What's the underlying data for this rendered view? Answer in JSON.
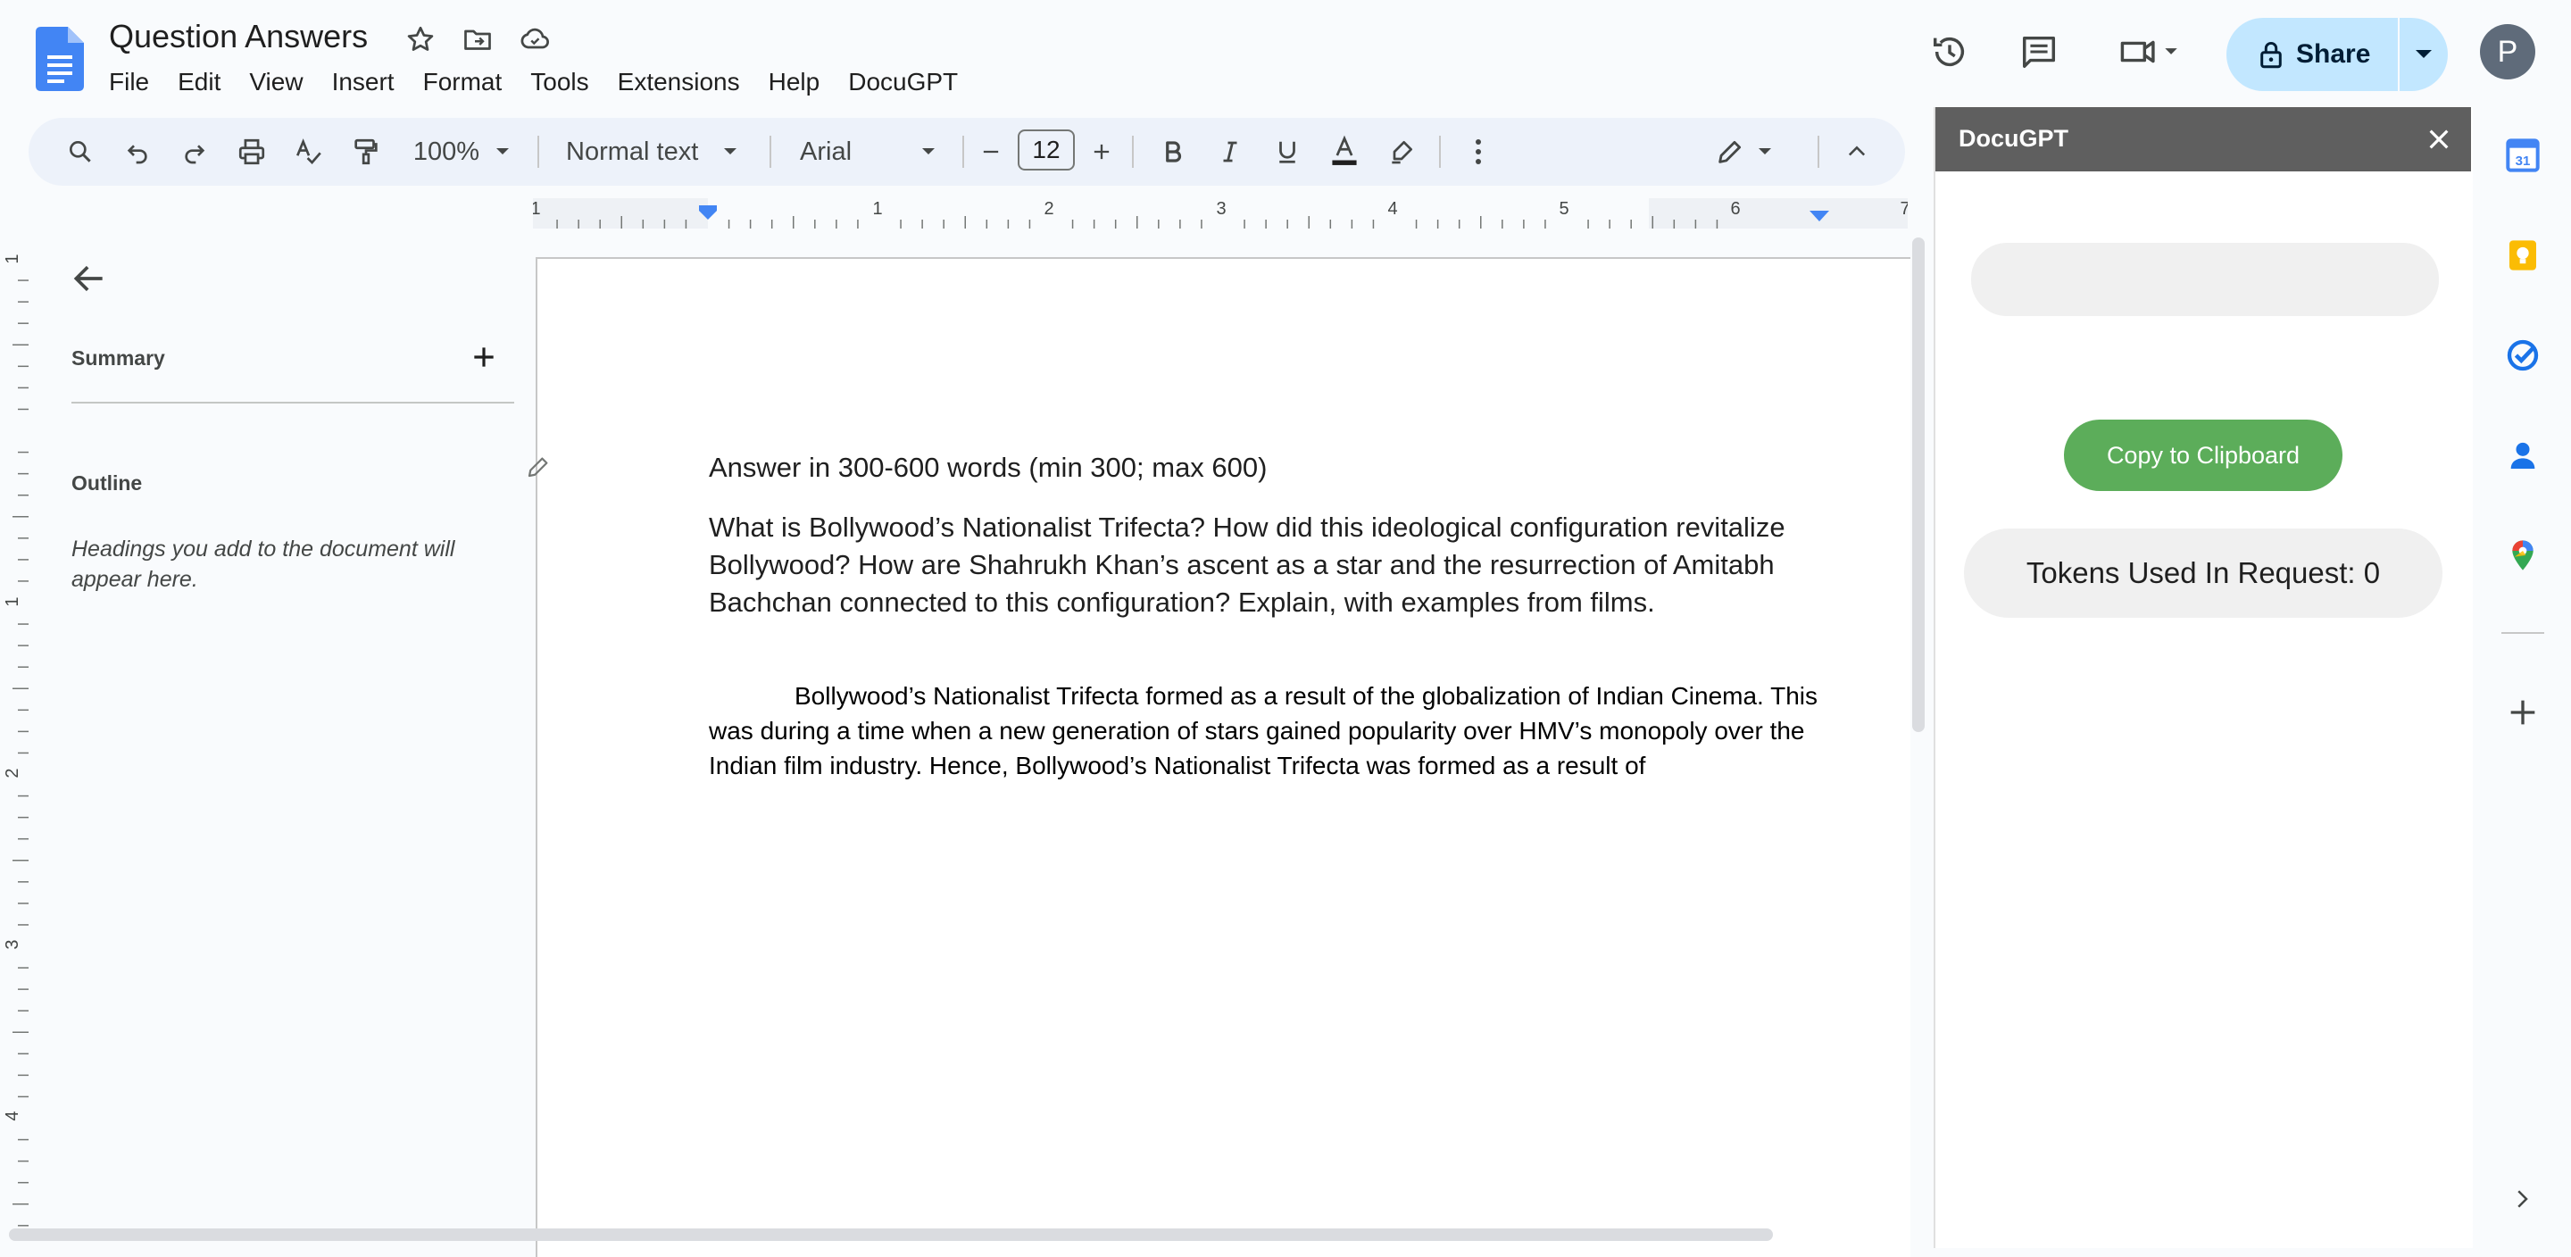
{
  "header": {
    "title": "Question Answers",
    "menu": [
      "File",
      "Edit",
      "View",
      "Insert",
      "Format",
      "Tools",
      "Extensions",
      "Help",
      "DocuGPT"
    ],
    "share_label": "Share",
    "avatar_letter": "P"
  },
  "toolbar": {
    "zoom": "100%",
    "style": "Normal text",
    "font": "Arial",
    "font_size": "12"
  },
  "ruler": {
    "h_ticks": [
      "1",
      "1",
      "2",
      "3",
      "4",
      "5",
      "6",
      "7"
    ],
    "v_ticks": [
      "1",
      "1",
      "2",
      "3",
      "4"
    ]
  },
  "outline_panel": {
    "summary_label": "Summary",
    "outline_label": "Outline",
    "outline_hint": "Headings you add to the document will appear here."
  },
  "document": {
    "heading": "Answer in 300-600 words (min 300; max 600)",
    "question": "What is Bollywood’s Nationalist Trifecta? How did this ideological configuration revitalize Bollywood? How are Shahrukh Khan’s ascent as a star and the resurrection of Amitabh Bachchan connected to this configuration? Explain, with examples from films.",
    "answer": "Bollywood’s Nationalist Trifecta formed as a result of the globalization of Indian Cinema. This was during a time when a new generation of stars gained popularity over HMV’s monopoly over the Indian film industry. Hence, Bollywood’s Nationalist Trifecta was formed as a result of"
  },
  "docugpt_panel": {
    "title": "DocuGPT",
    "input_value": "",
    "copy_label": "Copy to Clipboard",
    "tokens_text": "Tokens Used In Request: 0"
  },
  "addons": [
    "calendar-icon",
    "keep-icon",
    "tasks-icon",
    "contacts-icon",
    "maps-icon",
    "add-icon"
  ],
  "colors": {
    "share_bg": "#c2e7ff",
    "toolbar_bg": "#edf2fa",
    "panel_header": "#5f5f5f",
    "copy_button": "#5cad5a",
    "docs_blue": "#4285f4"
  }
}
